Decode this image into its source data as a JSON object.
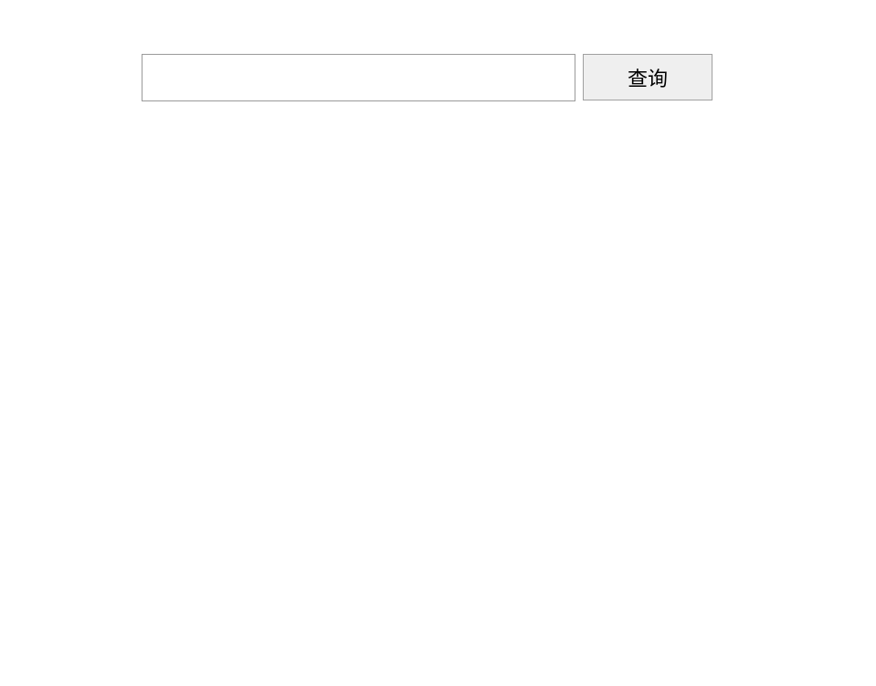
{
  "search": {
    "input_value": "",
    "button_label": "查询"
  }
}
